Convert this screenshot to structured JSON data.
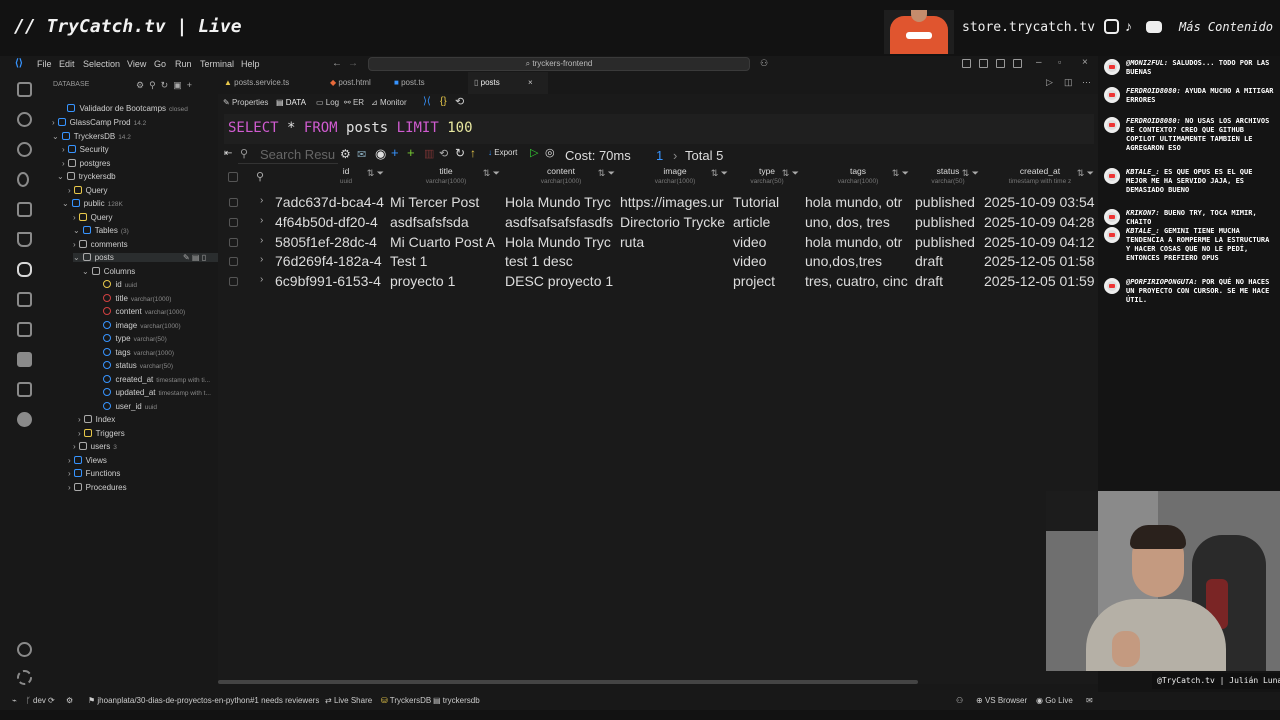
{
  "stream": {
    "title": "// TryCatch.tv | Live",
    "store_url": "store.trycatch.tv",
    "mas_contenido": "Más Contenido",
    "webcam_caption": "@TryCatch.tv | Julián Luna"
  },
  "menubar": {
    "items": [
      "File",
      "Edit",
      "Selection",
      "View",
      "Go",
      "Run",
      "Terminal",
      "Help"
    ],
    "command_center": "tryckers-frontend"
  },
  "sidebar": {
    "header": "DATABASE",
    "items": [
      {
        "label": "Validador de Bootcamps",
        "sub": "closed"
      },
      {
        "label": "GlassCamp Prod",
        "sub": "14.2"
      },
      {
        "label": "TryckersDB",
        "sub": "14.2"
      },
      {
        "label": "Security",
        "sub": ""
      },
      {
        "label": "postgres",
        "sub": ""
      },
      {
        "label": "tryckersdb",
        "sub": ""
      },
      {
        "label": "Query",
        "sub": ""
      },
      {
        "label": "public",
        "sub": "128K"
      },
      {
        "label": "Query",
        "sub": ""
      },
      {
        "label": "Tables",
        "sub": "(3)"
      },
      {
        "label": "comments",
        "sub": ""
      },
      {
        "label": "posts",
        "sub": ""
      },
      {
        "label": "Columns",
        "sub": ""
      },
      {
        "label": "id",
        "sub": "uuid"
      },
      {
        "label": "title",
        "sub": "varchar(1000)"
      },
      {
        "label": "content",
        "sub": "varchar(1000)"
      },
      {
        "label": "image",
        "sub": "varchar(1000)"
      },
      {
        "label": "type",
        "sub": "varchar(50)"
      },
      {
        "label": "tags",
        "sub": "varchar(1000)"
      },
      {
        "label": "status",
        "sub": "varchar(50)"
      },
      {
        "label": "created_at",
        "sub": "timestamp with ti..."
      },
      {
        "label": "updated_at",
        "sub": "timestamp with t..."
      },
      {
        "label": "user_id",
        "sub": "uuid"
      },
      {
        "label": "Index",
        "sub": ""
      },
      {
        "label": "Triggers",
        "sub": ""
      },
      {
        "label": "users",
        "sub": "3"
      },
      {
        "label": "Views",
        "sub": ""
      },
      {
        "label": "Functions",
        "sub": ""
      },
      {
        "label": "Procedures",
        "sub": ""
      }
    ]
  },
  "tabs": [
    "posts.service.ts",
    "post.html",
    "post.ts",
    "posts"
  ],
  "subtoolbar": [
    "Properties",
    "DATA",
    "Log",
    "ER",
    "Monitor"
  ],
  "sql": {
    "kw1": "SELECT",
    "star": "*",
    "kw2": "FROM",
    "table": "posts",
    "kw3": "LIMIT",
    "num": "100"
  },
  "results": {
    "search_placeholder": "Search Resu",
    "export": "Export",
    "cost": "Cost: 70ms",
    "page": "1",
    "total": "Total 5",
    "columns": [
      {
        "name": "id",
        "type": "uuid"
      },
      {
        "name": "title",
        "type": "varchar(1000)"
      },
      {
        "name": "content",
        "type": "varchar(1000)"
      },
      {
        "name": "image",
        "type": "varchar(1000)"
      },
      {
        "name": "type",
        "type": "varchar(50)"
      },
      {
        "name": "tags",
        "type": "varchar(1000)"
      },
      {
        "name": "status",
        "type": "varchar(50)"
      },
      {
        "name": "created_at",
        "type": "timestamp with time z"
      }
    ],
    "rows": [
      [
        "7adc637d-bca4-4",
        "Mi Tercer Post",
        "Hola Mundo Tryc",
        "https://images.ur",
        "Tutorial",
        "hola mundo, otr",
        "published",
        "2025-10-09 03:54"
      ],
      [
        "4f64b50d-df20-4",
        "asdfsafsfsda",
        "asdfsafsafsfasdfs",
        "Directorio Trycke",
        "article",
        "uno, dos, tres",
        "published",
        "2025-10-09 04:28"
      ],
      [
        "5805f1ef-28dc-4",
        "Mi Cuarto Post A",
        "Hola Mundo Tryc",
        "ruta",
        "video",
        "hola mundo, otr",
        "published",
        "2025-10-09 04:12"
      ],
      [
        "76d269f4-182a-4",
        "Test 1",
        "test 1 desc",
        "",
        "video",
        "uno,dos,tres",
        "draft",
        "2025-12-05 01:58"
      ],
      [
        "6c9bf991-6153-4",
        "proyecto 1",
        "DESC proyecto 1",
        "",
        "project",
        "tres, cuatro, cinc",
        "draft",
        "2025-12-05 01:59"
      ]
    ]
  },
  "statusbar": {
    "branch": "dev",
    "pr": "jhoanplata/30-dias-de-proyectos-en-python#1 needs reviewers",
    "live_share": "Live Share",
    "db": "TryckersDB",
    "schema": "tryckersdb",
    "vs_browser": "VS Browser",
    "go_live": "Go Live"
  },
  "chat": [
    {
      "user": "@MONI2FUL:",
      "text": "SALUDOS... TODO POR LAS BUENAS"
    },
    {
      "user": "FERDROID8080:",
      "text": "AYUDA MUCHO A MITIGAR ERRORES"
    },
    {
      "user": "FERDROID8080:",
      "text": "NO USAS LOS ARCHIVOS DE CONTEXTO? CREO QUE GITHUB COPILOT ULTIMAMENTE TAMBIEN LE AGREGARON ESO"
    },
    {
      "user": "KBTALE_:",
      "text": "ES QUE OPUS ES EL QUE MEJOR ME HA SERVIDO JAJA, ES DEMASIADO BUENO"
    },
    {
      "user": "KRIKON7:",
      "text": "BUENO TRY, TOCA MIMIR, CHAITO"
    },
    {
      "user": "KBTALE_:",
      "text": "GEMINI TIENE MUCHA TENDENCIA A ROMPERME LA ESTRUCTURA Y HACER COSAS QUE NO LE PEDÍ, ENTONCES PREFIERO OPUS"
    },
    {
      "user": "@PORFIRIOPONGUTA:",
      "text": "POR QUÉ NO HACES UN PROYECTO CON CURSOR. SE ME HACE ÚTIL."
    }
  ],
  "colors": {
    "keyword": "#d05bd0",
    "accent": "#3794ff",
    "bg": "#181818"
  }
}
